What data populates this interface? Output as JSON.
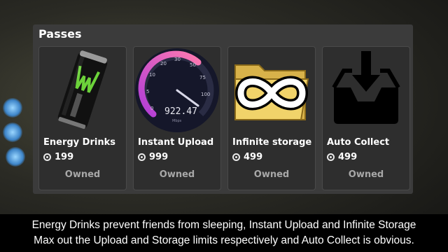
{
  "panel": {
    "title": "Passes"
  },
  "passes": [
    {
      "name": "Energy Drinks",
      "price": "199",
      "status": "Owned",
      "icon": "energy-drink-can-icon"
    },
    {
      "name": "Instant Upload",
      "price": "999",
      "status": "Owned",
      "icon": "speedometer-icon",
      "gauge": {
        "ticks": [
          "0",
          "5",
          "10",
          "20",
          "30",
          "50",
          "75",
          "100"
        ],
        "reading": "922.47",
        "unit": "Mbps"
      }
    },
    {
      "name": "Infinite storage",
      "price": "499",
      "status": "Owned",
      "icon": "infinity-folder-icon"
    },
    {
      "name": "Auto Collect",
      "price": "499",
      "status": "Owned",
      "icon": "download-tray-icon"
    }
  ],
  "caption": {
    "line1": "Energy Drinks prevent friends from sleeping, Instant Upload and Infinite Storage",
    "line2": "Max out the Upload and Storage limits respectively and Auto Collect is obvious."
  },
  "colors": {
    "panel": "#3b3b3b",
    "card": "#2e2e2e",
    "status": "#a8a8a8",
    "gauge_arc": "#e85fa0"
  }
}
